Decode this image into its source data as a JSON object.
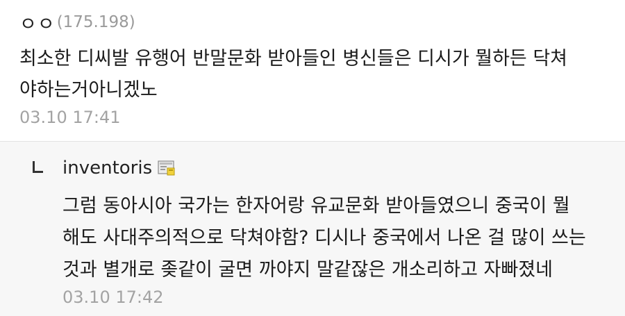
{
  "comment": {
    "nickname": "ㅇㅇ",
    "ip": "(175.198)",
    "text": "최소한 디씨발 유행어 반말문화 받아들인 병신들은 디시가 뭘하든 닥쳐\n야하는거아니겠노",
    "date": "03.10 17:41"
  },
  "reply": {
    "nickname": "inventoris",
    "badge_icon": "gallog-icon",
    "text": "그럼 동아시아 국가는 한자어랑 유교문화 받아들였으니 중국이 뭘\n해도 사대주의적으로 닥쳐야함? 디시나 중국에서 나온 걸 많이 쓰는\n것과 별개로 좆같이 굴면 까야지 말같잖은 개소리하고 자빠졌네",
    "date": "03.10 17:42"
  },
  "colors": {
    "text": "#1b1b1b",
    "meta": "#a3a3a3",
    "reply_bg": "#f7f7f7",
    "divider": "#e3e3e3"
  }
}
